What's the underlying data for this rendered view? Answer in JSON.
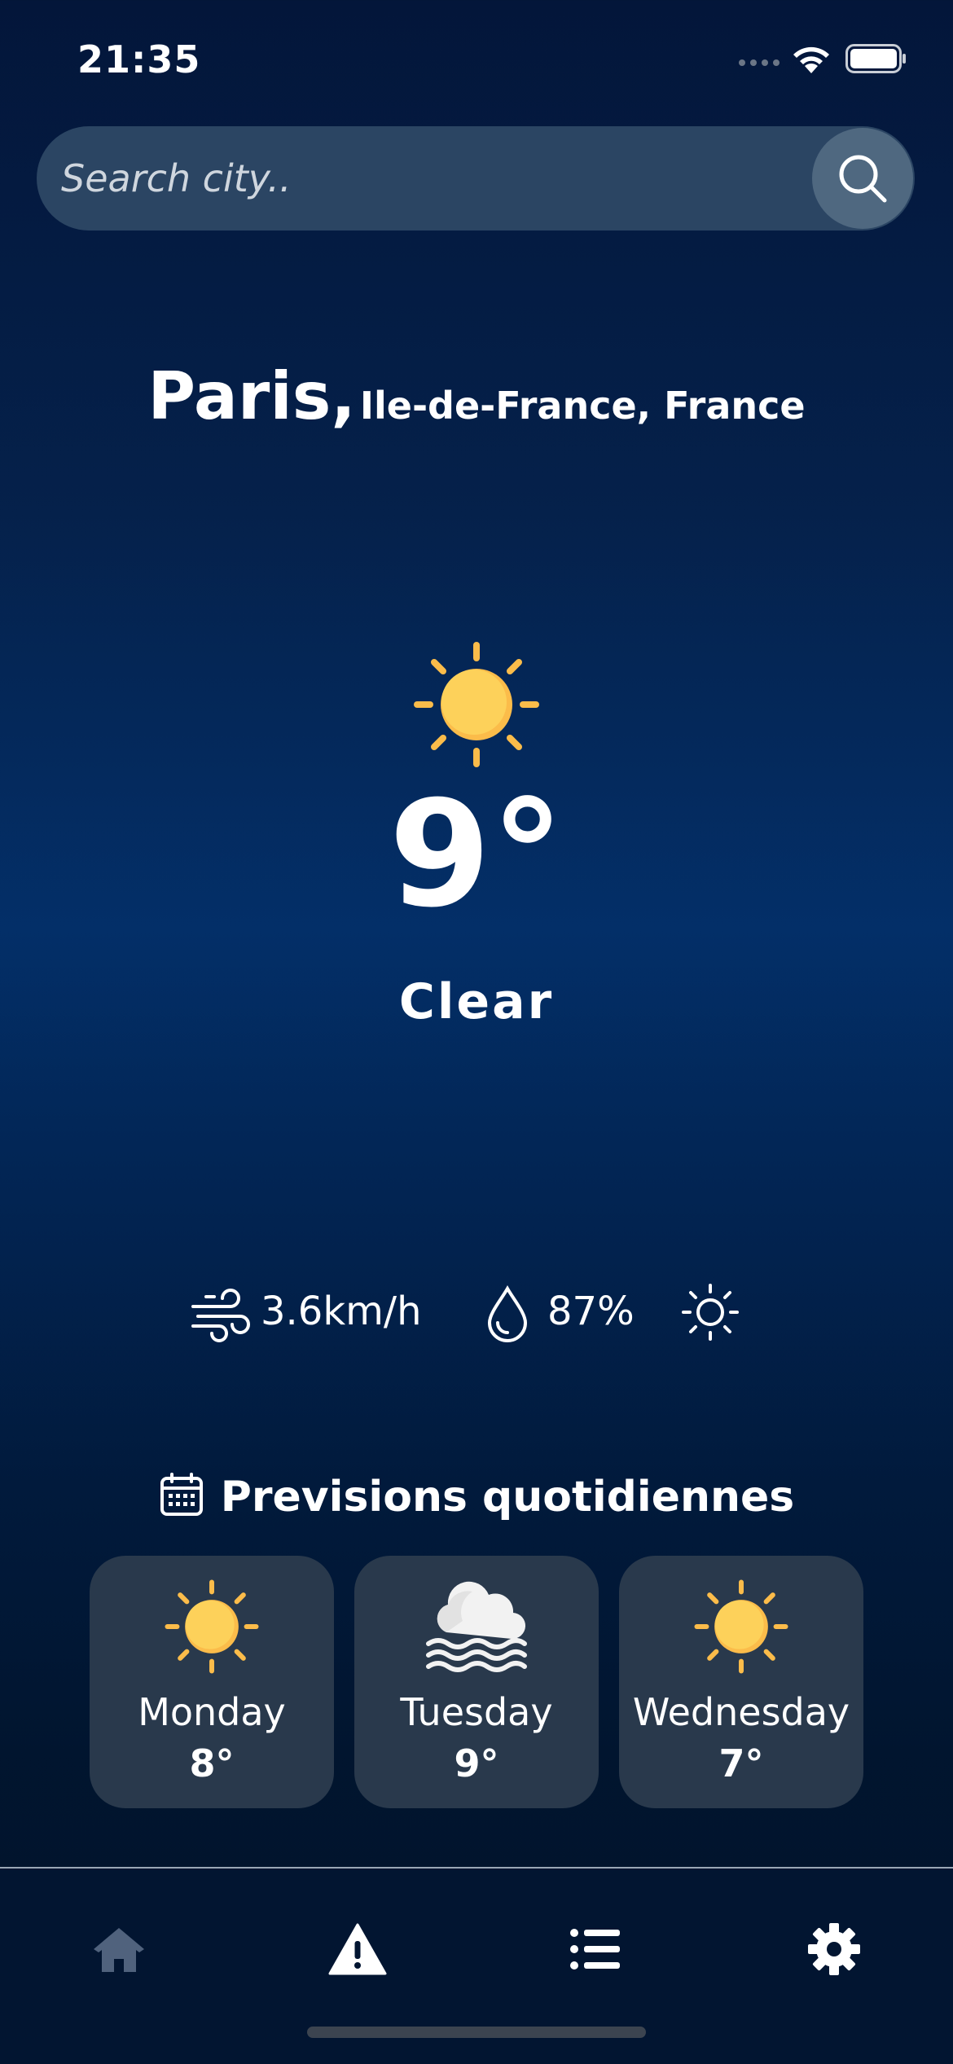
{
  "status_bar": {
    "time": "21:35"
  },
  "search": {
    "placeholder": "Search city.."
  },
  "location": {
    "city": "Paris,",
    "region": "Ile-de-France, France"
  },
  "current": {
    "temperature": "9°",
    "condition": "Clear",
    "icon": "sun-icon",
    "wind": "3.6km/h",
    "humidity": "87%"
  },
  "forecast": {
    "title": "Previsions quotidiennes",
    "days": [
      {
        "day": "Monday",
        "temp": "8°",
        "icon": "sun-icon"
      },
      {
        "day": "Tuesday",
        "temp": "9°",
        "icon": "fog-cloud-icon"
      },
      {
        "day": "Wednesday",
        "temp": "7°",
        "icon": "sun-icon"
      }
    ]
  },
  "tab_bar": {
    "items": [
      {
        "icon": "home-icon",
        "active": true
      },
      {
        "icon": "warning-icon",
        "active": false
      },
      {
        "icon": "list-icon",
        "active": false
      },
      {
        "icon": "gear-icon",
        "active": false
      }
    ]
  },
  "colors": {
    "sun_yellow": "#fdd15a",
    "sun_orange": "#fbbc4a",
    "card_bg": "#29394c",
    "search_bg": "#2b4563",
    "tab_inactive": "#50627d"
  }
}
